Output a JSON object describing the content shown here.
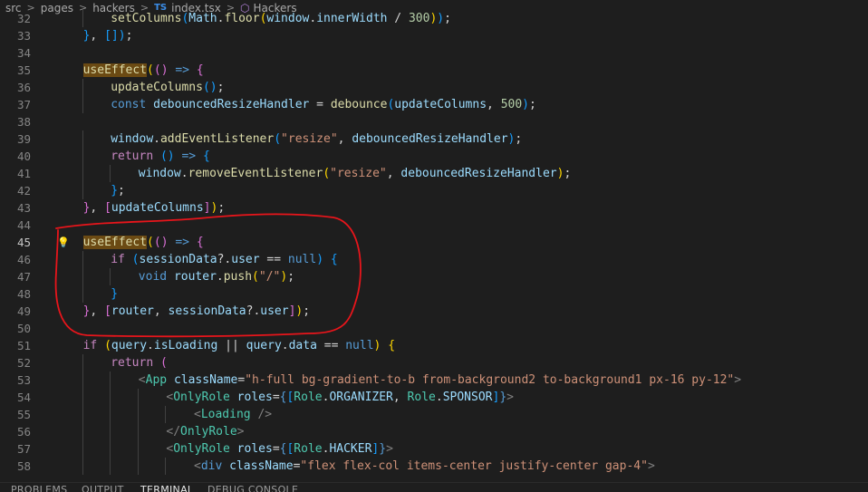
{
  "breadcrumb": [
    "src",
    "pages",
    "hackers",
    "index.tsx",
    "Hackers"
  ],
  "breadcrumb_icons": {
    "file": "typescript-file-icon",
    "symbol": "component-symbol-icon",
    "file_label": "TS"
  },
  "lines": [
    {
      "n": "32",
      "indent": 2,
      "tokens": [
        [
          "setColumns",
          "fn"
        ],
        [
          "(",
          "b3"
        ],
        [
          "Math",
          "var"
        ],
        [
          ".",
          ""
        ],
        [
          "floor",
          "fn"
        ],
        [
          "(",
          "b1"
        ],
        [
          "window",
          "var"
        ],
        [
          ".",
          ""
        ],
        [
          "innerWidth",
          "var"
        ],
        [
          " / ",
          ""
        ],
        [
          "300",
          "num"
        ],
        [
          ")",
          "b1"
        ],
        [
          ")",
          "b3"
        ],
        [
          ";",
          ""
        ]
      ]
    },
    {
      "n": "33",
      "indent": 1,
      "tokens": [
        [
          "}",
          "b3"
        ],
        [
          ", ",
          ""
        ],
        [
          "[]",
          "b3"
        ],
        [
          ")",
          "b3"
        ],
        [
          ";",
          ""
        ]
      ]
    },
    {
      "n": "34",
      "indent": 0,
      "tokens": []
    },
    {
      "n": "35",
      "indent": 1,
      "tokens": [
        [
          "useEffect",
          "fn hl"
        ],
        [
          "(",
          "b1"
        ],
        [
          "()",
          "b2"
        ],
        [
          " => ",
          "kw"
        ],
        [
          "{",
          "b2"
        ]
      ]
    },
    {
      "n": "36",
      "indent": 2,
      "tokens": [
        [
          "updateColumns",
          "fn"
        ],
        [
          "()",
          "b3"
        ],
        [
          ";",
          ""
        ]
      ]
    },
    {
      "n": "37",
      "indent": 2,
      "tokens": [
        [
          "const ",
          "kw"
        ],
        [
          "debouncedResizeHandler",
          "var"
        ],
        [
          " = ",
          ""
        ],
        [
          "debounce",
          "fn"
        ],
        [
          "(",
          "b3"
        ],
        [
          "updateColumns",
          "var"
        ],
        [
          ", ",
          ""
        ],
        [
          "500",
          "num"
        ],
        [
          ")",
          "b3"
        ],
        [
          ";",
          ""
        ]
      ]
    },
    {
      "n": "38",
      "indent": 0,
      "tokens": []
    },
    {
      "n": "39",
      "indent": 2,
      "tokens": [
        [
          "window",
          "var"
        ],
        [
          ".",
          ""
        ],
        [
          "addEventListener",
          "fn"
        ],
        [
          "(",
          "b3"
        ],
        [
          "\"resize\"",
          "str"
        ],
        [
          ", ",
          ""
        ],
        [
          "debouncedResizeHandler",
          "var"
        ],
        [
          ")",
          "b3"
        ],
        [
          ";",
          ""
        ]
      ]
    },
    {
      "n": "40",
      "indent": 2,
      "tokens": [
        [
          "return ",
          "ctl"
        ],
        [
          "()",
          "b3"
        ],
        [
          " => ",
          "kw"
        ],
        [
          "{",
          "b3"
        ]
      ]
    },
    {
      "n": "41",
      "indent": 3,
      "tokens": [
        [
          "window",
          "var"
        ],
        [
          ".",
          ""
        ],
        [
          "removeEventListener",
          "fn"
        ],
        [
          "(",
          "b1"
        ],
        [
          "\"resize\"",
          "str"
        ],
        [
          ", ",
          ""
        ],
        [
          "debouncedResizeHandler",
          "var"
        ],
        [
          ")",
          "b1"
        ],
        [
          ";",
          ""
        ]
      ]
    },
    {
      "n": "42",
      "indent": 2,
      "tokens": [
        [
          "}",
          "b3"
        ],
        [
          ";",
          ""
        ]
      ]
    },
    {
      "n": "43",
      "indent": 1,
      "tokens": [
        [
          "}",
          "b2"
        ],
        [
          ", ",
          ""
        ],
        [
          "[",
          "b2"
        ],
        [
          "updateColumns",
          "var"
        ],
        [
          "]",
          "b2"
        ],
        [
          ")",
          "b1"
        ],
        [
          ";",
          ""
        ]
      ]
    },
    {
      "n": "44",
      "indent": 0,
      "tokens": []
    },
    {
      "n": "45",
      "indent": 1,
      "active": true,
      "bulb": true,
      "tokens": [
        [
          "useEffect",
          "fn hl"
        ],
        [
          "(",
          "b1"
        ],
        [
          "()",
          "b2"
        ],
        [
          " => ",
          "kw"
        ],
        [
          "{",
          "b2"
        ]
      ]
    },
    {
      "n": "46",
      "indent": 2,
      "tokens": [
        [
          "if ",
          "ctl"
        ],
        [
          "(",
          "b3"
        ],
        [
          "sessionData",
          "var"
        ],
        [
          "?.",
          ""
        ],
        [
          "user",
          "var"
        ],
        [
          " == ",
          ""
        ],
        [
          "null",
          "kw"
        ],
        [
          ")",
          "b3"
        ],
        [
          " ",
          ""
        ],
        [
          "{",
          "b3"
        ]
      ]
    },
    {
      "n": "47",
      "indent": 3,
      "tokens": [
        [
          "void ",
          "kw"
        ],
        [
          "router",
          "var"
        ],
        [
          ".",
          ""
        ],
        [
          "push",
          "fn"
        ],
        [
          "(",
          "b1"
        ],
        [
          "\"/\"",
          "str"
        ],
        [
          ")",
          "b1"
        ],
        [
          ";",
          ""
        ]
      ]
    },
    {
      "n": "48",
      "indent": 2,
      "tokens": [
        [
          "}",
          "b3"
        ]
      ]
    },
    {
      "n": "49",
      "indent": 1,
      "tokens": [
        [
          "}",
          "b2"
        ],
        [
          ", ",
          ""
        ],
        [
          "[",
          "b2"
        ],
        [
          "router",
          "var"
        ],
        [
          ", ",
          ""
        ],
        [
          "sessionData",
          "var"
        ],
        [
          "?.",
          ""
        ],
        [
          "user",
          "var"
        ],
        [
          "]",
          "b2"
        ],
        [
          ")",
          "b1"
        ],
        [
          ";",
          ""
        ]
      ]
    },
    {
      "n": "50",
      "indent": 0,
      "tokens": []
    },
    {
      "n": "51",
      "indent": 1,
      "tokens": [
        [
          "if ",
          "ctl"
        ],
        [
          "(",
          "b1"
        ],
        [
          "query",
          "var"
        ],
        [
          ".",
          ""
        ],
        [
          "isLoading",
          "var"
        ],
        [
          " || ",
          ""
        ],
        [
          "query",
          "var"
        ],
        [
          ".",
          ""
        ],
        [
          "data",
          "var"
        ],
        [
          " == ",
          ""
        ],
        [
          "null",
          "kw"
        ],
        [
          ")",
          "b1"
        ],
        [
          " ",
          ""
        ],
        [
          "{",
          "b1"
        ]
      ]
    },
    {
      "n": "52",
      "indent": 2,
      "tokens": [
        [
          "return ",
          "ctl"
        ],
        [
          "(",
          "b2"
        ]
      ]
    },
    {
      "n": "53",
      "indent": 3,
      "tokens": [
        [
          "<",
          "gray"
        ],
        [
          "App ",
          "cls"
        ],
        [
          "className",
          "attr"
        ],
        [
          "=",
          ""
        ],
        [
          "\"h-full bg-gradient-to-b from-background2 to-background1 px-16 py-12\"",
          "str"
        ],
        [
          ">",
          "gray"
        ]
      ]
    },
    {
      "n": "54",
      "indent": 4,
      "tokens": [
        [
          "<",
          "gray"
        ],
        [
          "OnlyRole ",
          "cls"
        ],
        [
          "roles",
          "attr"
        ],
        [
          "=",
          ""
        ],
        [
          "{",
          "kw"
        ],
        [
          "[",
          "b3"
        ],
        [
          "Role",
          "cls"
        ],
        [
          ".",
          ""
        ],
        [
          "ORGANIZER",
          "var"
        ],
        [
          ", ",
          ""
        ],
        [
          "Role",
          "cls"
        ],
        [
          ".",
          ""
        ],
        [
          "SPONSOR",
          "var"
        ],
        [
          "]",
          "b3"
        ],
        [
          "}",
          "kw"
        ],
        [
          ">",
          "gray"
        ]
      ]
    },
    {
      "n": "55",
      "indent": 5,
      "tokens": [
        [
          "<",
          "gray"
        ],
        [
          "Loading ",
          "cls"
        ],
        [
          "/>",
          "gray"
        ]
      ]
    },
    {
      "n": "56",
      "indent": 4,
      "tokens": [
        [
          "</",
          "gray"
        ],
        [
          "OnlyRole",
          "cls"
        ],
        [
          ">",
          "gray"
        ]
      ]
    },
    {
      "n": "57",
      "indent": 4,
      "tokens": [
        [
          "<",
          "gray"
        ],
        [
          "OnlyRole ",
          "cls"
        ],
        [
          "roles",
          "attr"
        ],
        [
          "=",
          ""
        ],
        [
          "{",
          "kw"
        ],
        [
          "[",
          "b3"
        ],
        [
          "Role",
          "cls"
        ],
        [
          ".",
          ""
        ],
        [
          "HACKER",
          "var"
        ],
        [
          "]",
          "b3"
        ],
        [
          "}",
          "kw"
        ],
        [
          ">",
          "gray"
        ]
      ]
    },
    {
      "n": "58",
      "indent": 5,
      "tokens": [
        [
          "<",
          "gray"
        ],
        [
          "div ",
          "tag"
        ],
        [
          "className",
          "attr"
        ],
        [
          "=",
          ""
        ],
        [
          "\"flex flex-col items-center justify-center gap-4\"",
          "str"
        ],
        [
          ">",
          "gray"
        ]
      ]
    }
  ],
  "panel_tabs": [
    "PROBLEMS",
    "OUTPUT",
    "TERMINAL",
    "DEBUG CONSOLE"
  ],
  "active_panel_tab": "TERMINAL",
  "colors": {
    "annotation": "#e8151b",
    "highlight": "#6b4a13",
    "background": "#1e1e1e"
  }
}
